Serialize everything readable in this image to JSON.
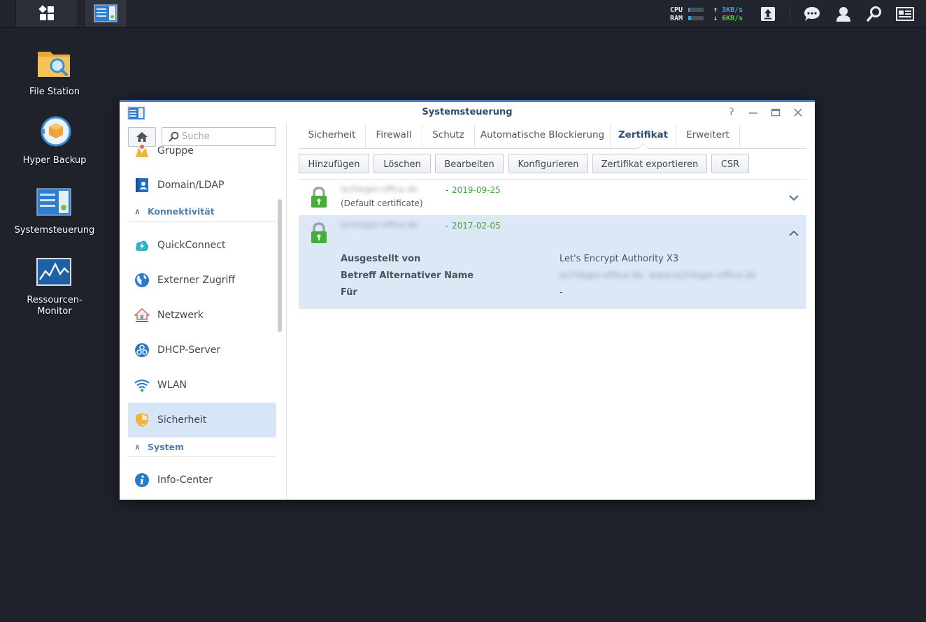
{
  "taskbar": {
    "cpu_label": "CPU",
    "ram_label": "RAM",
    "cpu_load": 0.1,
    "ram_load": 0.2,
    "upload": "3KB/s",
    "download": "6KB/s",
    "colors": {
      "upload": "#3aa0e8",
      "download": "#5cc940"
    }
  },
  "desktop": {
    "icons": [
      {
        "label": "File Station",
        "icon": "folder-search-icon"
      },
      {
        "label": "Hyper Backup",
        "icon": "hyper-backup-icon"
      },
      {
        "label": "Systemsteuerung",
        "icon": "control-panel-icon"
      },
      {
        "label": "Ressourcen-\nMonitor",
        "line1": "Ressourcen-",
        "line2": "Monitor",
        "icon": "resource-monitor-icon"
      }
    ]
  },
  "window": {
    "title": "Systemsteuerung",
    "accent": "#4b7bbc"
  },
  "sidebar": {
    "search_placeholder": "Suche",
    "items_top": [
      {
        "label": "Gruppe",
        "icon": "group-icon"
      },
      {
        "label": "Domain/LDAP",
        "icon": "domain-ldap-icon"
      }
    ],
    "section_connectivity": "Konnektivität",
    "items_connectivity": [
      {
        "label": "QuickConnect",
        "icon": "quickconnect-icon"
      },
      {
        "label": "Externer Zugriff",
        "icon": "globe-icon"
      },
      {
        "label": "Netzwerk",
        "icon": "network-house-icon"
      },
      {
        "label": "DHCP-Server",
        "icon": "dhcp-icon"
      },
      {
        "label": "WLAN",
        "icon": "wifi-icon"
      },
      {
        "label": "Sicherheit",
        "icon": "shield-icon",
        "active": true
      }
    ],
    "section_system": "System",
    "items_system": [
      {
        "label": "Info-Center",
        "icon": "info-icon"
      }
    ]
  },
  "tabs": [
    {
      "label": "Sicherheit"
    },
    {
      "label": "Firewall"
    },
    {
      "label": "Schutz"
    },
    {
      "label": "Automatische Blockierung"
    },
    {
      "label": "Zertifikat",
      "active": true
    },
    {
      "label": "Erweitert"
    }
  ],
  "toolbar": {
    "add": "Hinzufügen",
    "delete": "Löschen",
    "edit": "Bearbeiten",
    "configure": "Konfigurieren",
    "export": "Zertifikat exportieren",
    "csr": "CSR"
  },
  "certificates": [
    {
      "name": "lschleger-office.de",
      "date": "2019-09-25",
      "note": "(Default certificate)",
      "expanded": false
    },
    {
      "name": "lschleger-office.de",
      "date": "2017-02-05",
      "expanded": true,
      "details": [
        {
          "label": "Ausgestellt von",
          "value": "Let's Encrypt Authority X3"
        },
        {
          "label": "Betreff Alternativer Name",
          "value": "lschleger-office.de, www.lschleger-office.de",
          "blurred": true
        },
        {
          "label": "Für",
          "value": "-"
        }
      ]
    }
  ],
  "dash": "-"
}
